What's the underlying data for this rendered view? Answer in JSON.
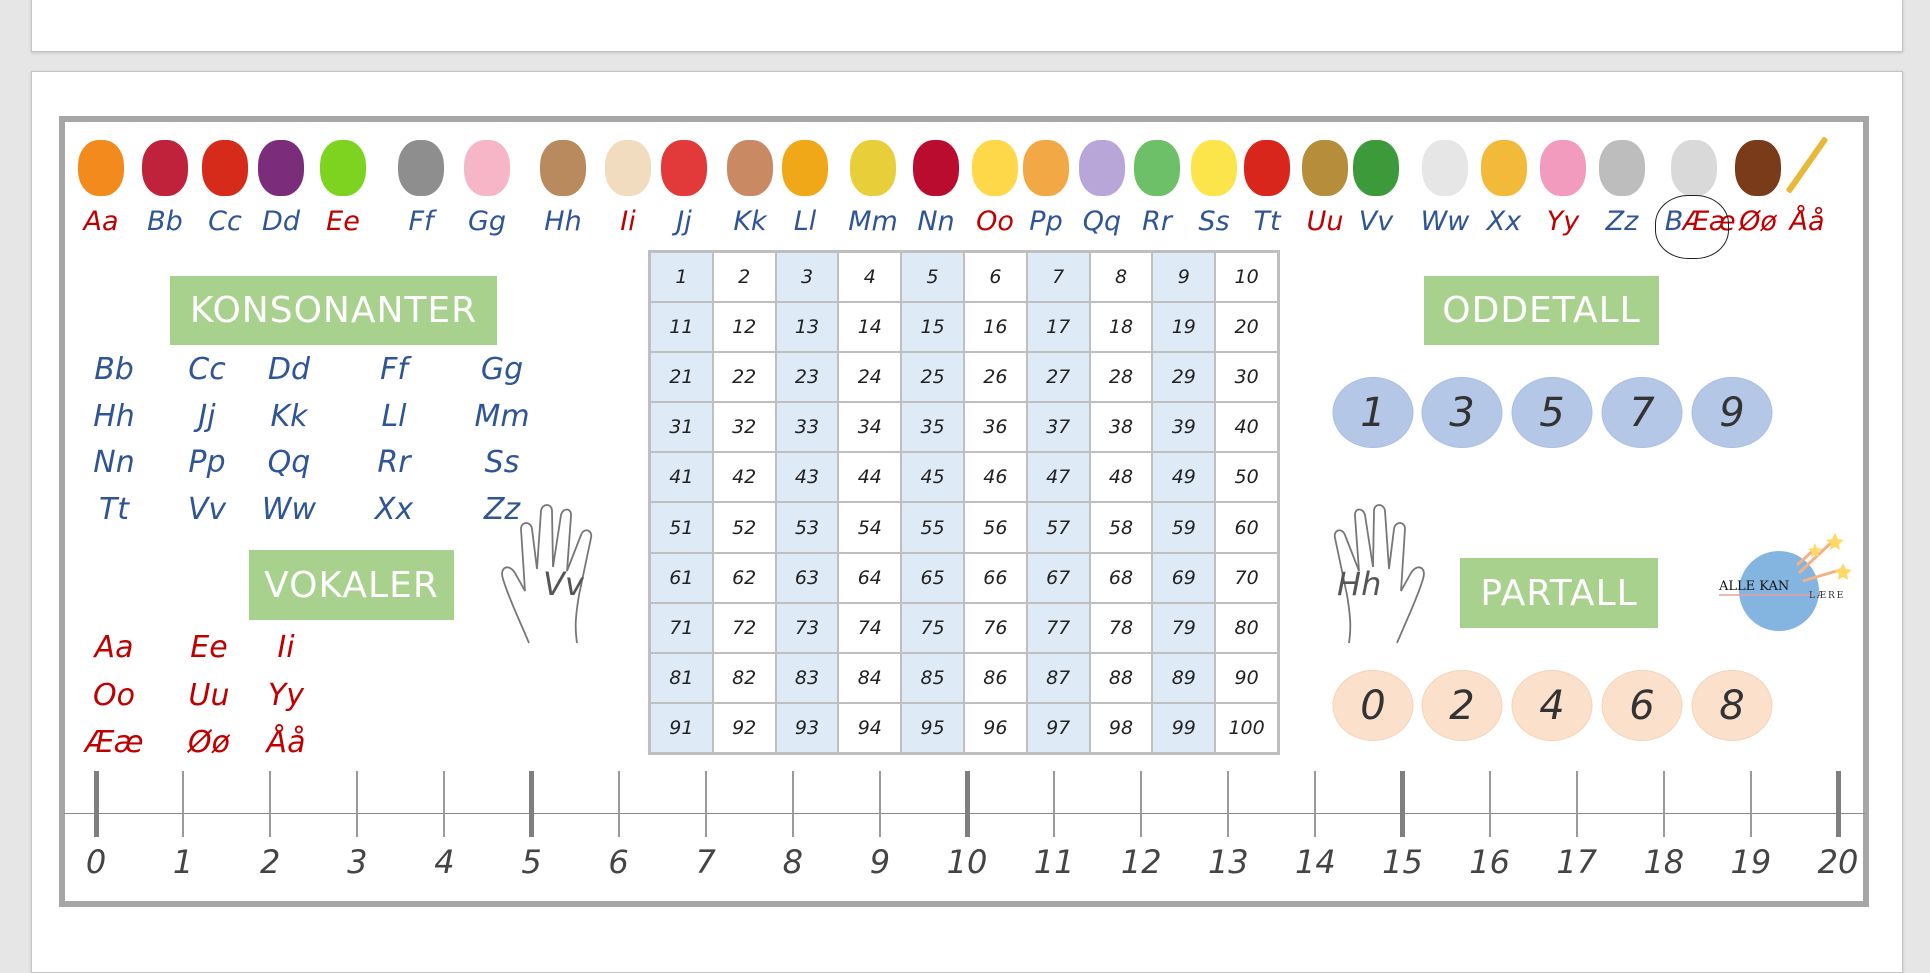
{
  "colors": {
    "vowel": "#c00000",
    "consonant": "#2f5597",
    "label_bg": "#a9d18e",
    "odd_bubble": "#b4c7e7",
    "even_bubble": "#fbe0cc",
    "odd_column": "#deebf7"
  },
  "alphabet": [
    {
      "text": "Aa",
      "type": "vowel",
      "icon": "orange-icon"
    },
    {
      "text": "Bb",
      "type": "consonant",
      "icon": "raspberry-icon"
    },
    {
      "text": "Cc",
      "type": "consonant",
      "icon": "chili-icon"
    },
    {
      "text": "Dd",
      "type": "consonant",
      "icon": "grapes-icon"
    },
    {
      "text": "Ee",
      "type": "vowel",
      "icon": "apple-icon"
    },
    {
      "text": "Ff",
      "type": "consonant",
      "icon": "hippo-icon"
    },
    {
      "text": "Gg",
      "type": "consonant",
      "icon": "pig-icon"
    },
    {
      "text": "Hh",
      "type": "consonant",
      "icon": "dog-icon"
    },
    {
      "text": "Ii",
      "type": "vowel",
      "icon": "ice-cream-icon"
    },
    {
      "text": "Jj",
      "type": "consonant",
      "icon": "strawberry-icon"
    },
    {
      "text": "Kk",
      "type": "consonant",
      "icon": "cow-icon"
    },
    {
      "text": "Ll",
      "type": "consonant",
      "icon": "lion-icon"
    },
    {
      "text": "Mm",
      "type": "consonant",
      "icon": "corn-icon"
    },
    {
      "text": "Nn",
      "type": "consonant",
      "icon": "norway-flag-icon"
    },
    {
      "text": "Oo",
      "type": "vowel",
      "icon": "cheese-icon"
    },
    {
      "text": "Pp",
      "type": "consonant",
      "icon": "pizza-icon"
    },
    {
      "text": "Qq",
      "type": "consonant",
      "icon": "letter-q-icon"
    },
    {
      "text": "Rr",
      "type": "consonant",
      "icon": "rainbow-icon"
    },
    {
      "text": "Ss",
      "type": "consonant",
      "icon": "lemon-icon"
    },
    {
      "text": "Tt",
      "type": "consonant",
      "icon": "tomato-icon"
    },
    {
      "text": "Uu",
      "type": "vowel",
      "icon": "owl-icon"
    },
    {
      "text": "Vv",
      "type": "consonant",
      "icon": "watermelon-icon"
    },
    {
      "text": "Ww",
      "type": "consonant",
      "icon": "toilet-icon"
    },
    {
      "text": "Xx",
      "type": "consonant",
      "icon": "letter-x-icon"
    },
    {
      "text": "Yy",
      "type": "vowel",
      "icon": "yogurt-icon"
    },
    {
      "text": "Zz",
      "type": "consonant",
      "icon": "zebra-icon"
    },
    {
      "text": "B",
      "type": "consonant",
      "icon": "sheep-icon"
    },
    {
      "text": "Ææ",
      "type": "vowel",
      "icon": ""
    },
    {
      "text": "Øø",
      "type": "vowel",
      "icon": "eagle-icon"
    },
    {
      "text": "Åå",
      "type": "vowel",
      "icon": "paddle-icon"
    }
  ],
  "konsonanter": {
    "title": "KONSONANTER",
    "rows": [
      [
        "Bb",
        "Cc",
        "Dd",
        "Ff",
        "Gg"
      ],
      [
        "Hh",
        "Jj",
        "Kk",
        "Ll",
        "Mm"
      ],
      [
        "Nn",
        "Pp",
        "Qq",
        "Rr",
        "Ss"
      ],
      [
        "Tt",
        "Vv",
        "Ww",
        "Xx",
        "Zz"
      ]
    ]
  },
  "vokaler": {
    "title": "VOKALER",
    "rows": [
      [
        "Aa",
        "Ee",
        "Ii"
      ],
      [
        "Oo",
        "Uu",
        "Yy"
      ],
      [
        "Ææ",
        "Øø",
        "Åå"
      ]
    ]
  },
  "hands": {
    "left": "Vv",
    "right": "Hh"
  },
  "hundred_grid": [
    "1",
    "2",
    "3",
    "4",
    "5",
    "6",
    "7",
    "8",
    "9",
    "10",
    "11",
    "12",
    "13",
    "14",
    "15",
    "16",
    "17",
    "18",
    "19",
    "20",
    "21",
    "22",
    "23",
    "24",
    "25",
    "26",
    "27",
    "28",
    "29",
    "30",
    "31",
    "32",
    "33",
    "34",
    "35",
    "36",
    "37",
    "38",
    "39",
    "40",
    "41",
    "42",
    "43",
    "44",
    "45",
    "46",
    "47",
    "48",
    "49",
    "50",
    "51",
    "52",
    "53",
    "54",
    "55",
    "56",
    "57",
    "58",
    "59",
    "60",
    "61",
    "62",
    "63",
    "64",
    "65",
    "66",
    "67",
    "68",
    "69",
    "70",
    "71",
    "72",
    "73",
    "74",
    "75",
    "76",
    "77",
    "78",
    "79",
    "80",
    "81",
    "82",
    "83",
    "84",
    "85",
    "86",
    "87",
    "88",
    "89",
    "90",
    "91",
    "92",
    "93",
    "94",
    "95",
    "96",
    "97",
    "98",
    "99",
    "100"
  ],
  "oddetall": {
    "title": "ODDETALL",
    "numbers": [
      "1",
      "3",
      "5",
      "7",
      "9"
    ]
  },
  "partall": {
    "title": "PARTALL",
    "numbers": [
      "0",
      "2",
      "4",
      "6",
      "8"
    ]
  },
  "logo": {
    "text": "ALLE KAN",
    "arc_text": "LÆRE"
  },
  "number_line": [
    "0",
    "1",
    "2",
    "3",
    "4",
    "5",
    "6",
    "7",
    "8",
    "9",
    "10",
    "11",
    "12",
    "13",
    "14",
    "15",
    "16",
    "17",
    "18",
    "19",
    "20"
  ]
}
